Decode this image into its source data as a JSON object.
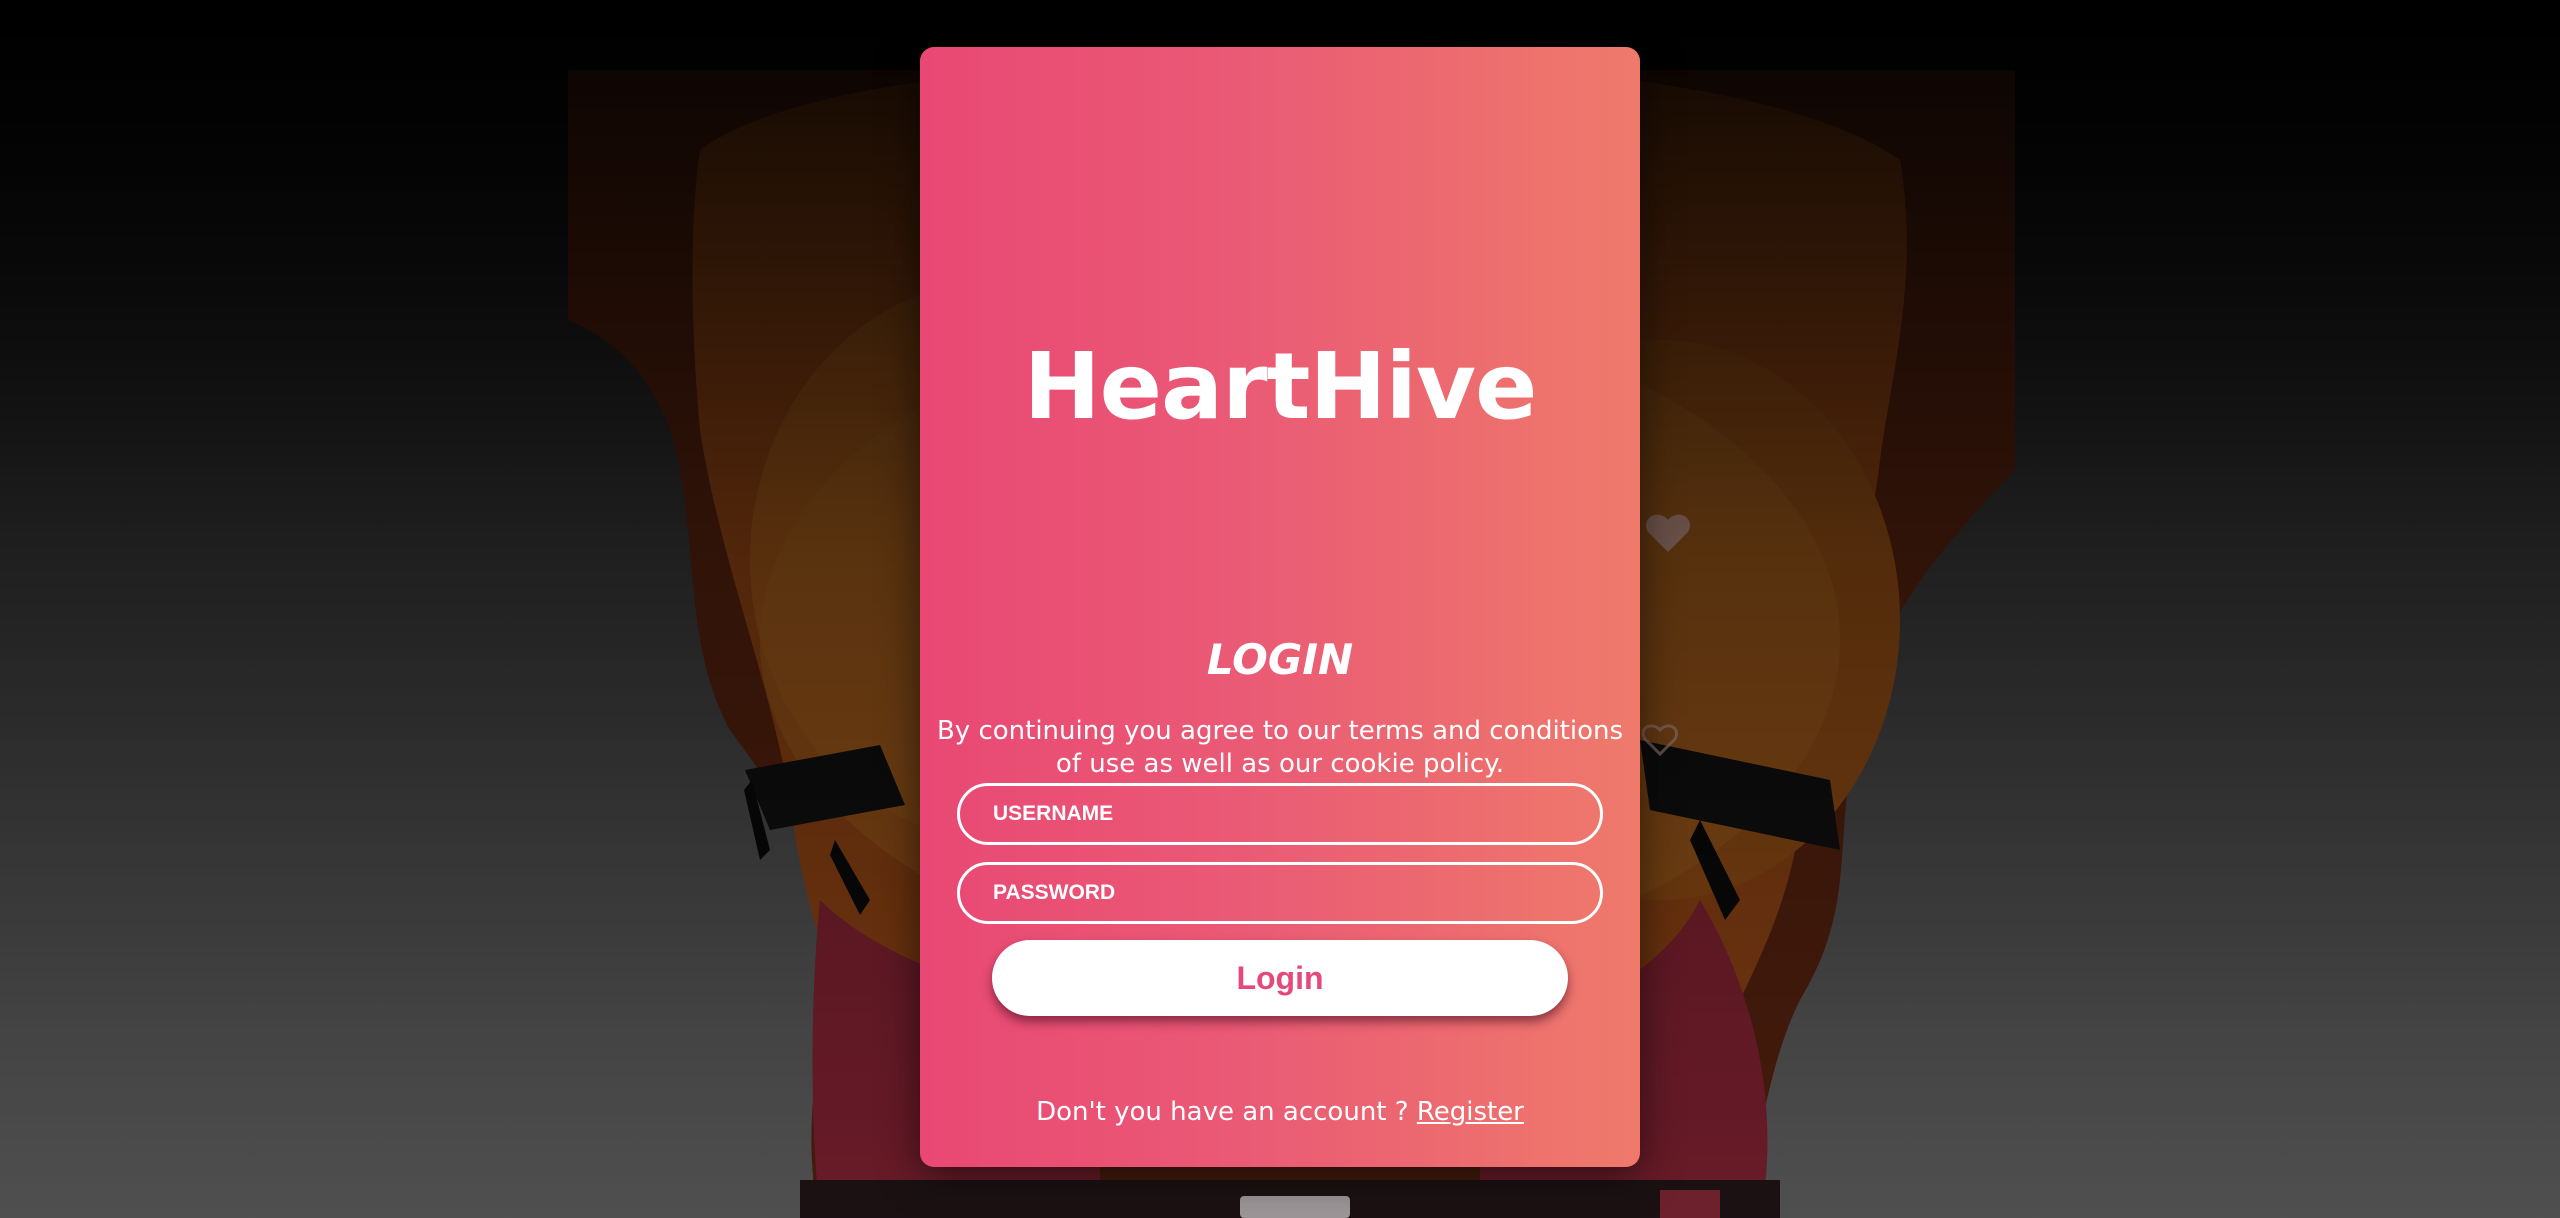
{
  "app": {
    "brand": "HeartHive"
  },
  "login": {
    "title": "LOGIN",
    "terms": "By continuing you agree to our terms and conditions of use as well as our cookie policy.",
    "username_placeholder": "USERNAME",
    "password_placeholder": "PASSWORD",
    "submit_label": "Login",
    "no_account_text": "Don't you have an account ?",
    "register_label": "Register"
  },
  "colors": {
    "card_gradient_start": "#e94874",
    "card_gradient_end": "#ef7a6b",
    "button_text": "#e5487a",
    "page_background_top": "#000000",
    "page_background_bottom": "#7a7a7a"
  },
  "icons": {
    "background_art": "couple-hugging-illustration"
  }
}
